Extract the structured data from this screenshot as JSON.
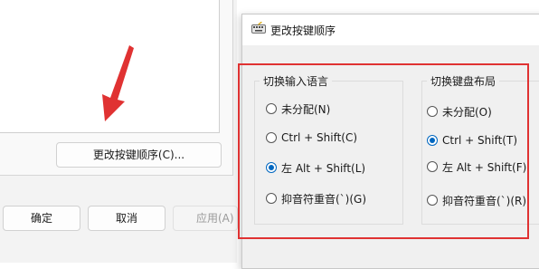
{
  "background_dialog": {
    "change_key_sequence_button": "更改按键顺序(C)...",
    "ok_button": "确定",
    "cancel_button": "取消",
    "apply_button": "应用(A)"
  },
  "dialog": {
    "title": "更改按键顺序",
    "groups": [
      {
        "title": "切换输入语言",
        "options": [
          {
            "label": "未分配(N)",
            "checked": false
          },
          {
            "label": "Ctrl + Shift(C)",
            "checked": false
          },
          {
            "label": "左 Alt + Shift(L)",
            "checked": true
          },
          {
            "label": "抑音符重音(`)(G)",
            "checked": false
          }
        ]
      },
      {
        "title": "切换键盘布局",
        "options": [
          {
            "label": "未分配(O)",
            "checked": false
          },
          {
            "label": "Ctrl + Shift(T)",
            "checked": true
          },
          {
            "label": "左 Alt + Shift(F)",
            "checked": false
          },
          {
            "label": "抑音符重音(`)(R)",
            "checked": false
          }
        ]
      }
    ]
  },
  "colors": {
    "accent": "#0067c0",
    "highlight_border": "#e03232",
    "arrow": "#e03232"
  },
  "icons": {
    "title_icon": "keyboard-icon",
    "pointer": "arrow-icon"
  }
}
